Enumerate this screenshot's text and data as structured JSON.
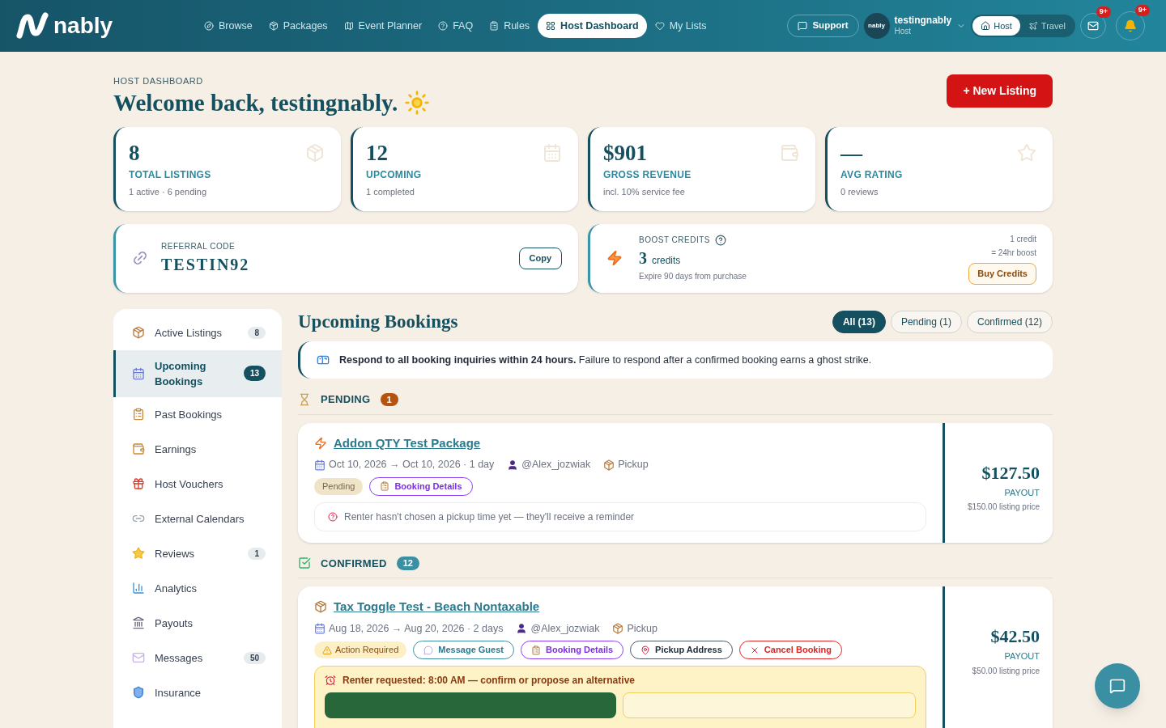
{
  "nav": {
    "logo": "nably",
    "links": [
      {
        "label": "Browse",
        "selected": false
      },
      {
        "label": "Packages",
        "selected": false
      },
      {
        "label": "Event Planner",
        "selected": false
      },
      {
        "label": "FAQ",
        "selected": false
      },
      {
        "label": "Rules",
        "selected": false
      },
      {
        "label": "Host Dashboard",
        "selected": true
      },
      {
        "label": "My Lists",
        "selected": false
      }
    ],
    "support": "Support",
    "avatar_text": "nably",
    "user": {
      "name": "testingnably",
      "role": "Host"
    },
    "modes": [
      {
        "label": "Host",
        "selected": true
      },
      {
        "label": "Travel",
        "selected": false
      }
    ],
    "mail_badge": "9+",
    "bell_badge": "9+"
  },
  "header": {
    "eyebrow": "HOST DASHBOARD",
    "title": "Welcome back, testingnably.",
    "new_listing": "+ New Listing"
  },
  "stats": [
    {
      "value": "8",
      "label": "TOTAL LISTINGS",
      "sub": "1 active · 6 pending"
    },
    {
      "value": "12",
      "label": "UPCOMING",
      "sub": "1 completed"
    },
    {
      "value": "$901",
      "label": "GROSS REVENUE",
      "sub": "incl. 10% service fee"
    },
    {
      "value": "—",
      "label": "AVG RATING",
      "sub": "0 reviews"
    }
  ],
  "referral": {
    "label": "REFERRAL CODE",
    "code": "TESTIN92",
    "button": "Copy"
  },
  "boost": {
    "label": "BOOST CREDITS",
    "count": "3",
    "unit": "credits",
    "note": "Expire 90 days from purchase",
    "rate": [
      "1 credit",
      "= 24hr boost"
    ],
    "button": "Buy Credits"
  },
  "sidebar": [
    {
      "label": "Active Listings",
      "count": "8",
      "selected": false
    },
    {
      "label": "Upcoming Bookings",
      "count": "13",
      "selected": true
    },
    {
      "label": "Past Bookings",
      "selected": false
    },
    {
      "label": "Earnings",
      "selected": false
    },
    {
      "label": "Host Vouchers",
      "selected": false
    },
    {
      "label": "External Calendars",
      "selected": false
    },
    {
      "label": "Reviews",
      "count": "1",
      "selected": false
    },
    {
      "label": "Analytics",
      "selected": false
    },
    {
      "label": "Payouts",
      "selected": false
    },
    {
      "label": "Messages",
      "count": "50",
      "selected": false
    },
    {
      "label": "Insurance",
      "selected": false
    }
  ],
  "bookings": {
    "title": "Upcoming Bookings",
    "filters": [
      {
        "label": "All (13)",
        "selected": true
      },
      {
        "label": "Pending (1)",
        "selected": false
      },
      {
        "label": "Confirmed (12)",
        "selected": false
      }
    ],
    "notice": "**Respond to all booking inquiries within 24 hours.** Failure to respond after a confirmed booking earns a ghost strike.",
    "sections": [
      {
        "kind": "pending",
        "title": "PENDING",
        "count": "1",
        "items": [
          {
            "kind": "bolt",
            "title": "Addon QTY Test Package",
            "dates": "Oct 10, 2026 → Oct 10, 2026 · 1 day",
            "user": "@Alex_jozwiak",
            "method": "Pickup",
            "status": {
              "kind": "pending",
              "label": "Pending"
            },
            "actions": [
              {
                "kind": "details",
                "label": "Booking Details"
              }
            ],
            "note": {
              "kind": "info",
              "text": "Renter hasn't chosen a pickup time yet — they'll receive a reminder"
            },
            "payout": "$127.50",
            "payout_label": "PAYOUT",
            "listing_price": "$150.00 listing price"
          }
        ]
      },
      {
        "kind": "confirmed",
        "title": "CONFIRMED",
        "count": "12",
        "items": [
          {
            "kind": "box",
            "title": "Tax Toggle Test - Beach Nontaxable",
            "dates": "Aug 18, 2026 → Aug 20, 2026 · 2 days",
            "user": "@Alex_jozwiak",
            "method": "Pickup",
            "status": {
              "kind": "action",
              "label": "Action Required"
            },
            "actions": [
              {
                "kind": "message",
                "label": "Message Guest"
              },
              {
                "kind": "details",
                "label": "Booking Details"
              },
              {
                "kind": "address",
                "label": "Pickup Address"
              },
              {
                "kind": "cancel",
                "label": "Cancel Booking"
              }
            ],
            "note": {
              "kind": "request",
              "text": "Renter requested: 8:00 AM — confirm or propose an alternative"
            },
            "payout": "$42.50",
            "payout_label": "PAYOUT",
            "listing_price": "$50.00 listing price"
          }
        ]
      }
    ]
  }
}
